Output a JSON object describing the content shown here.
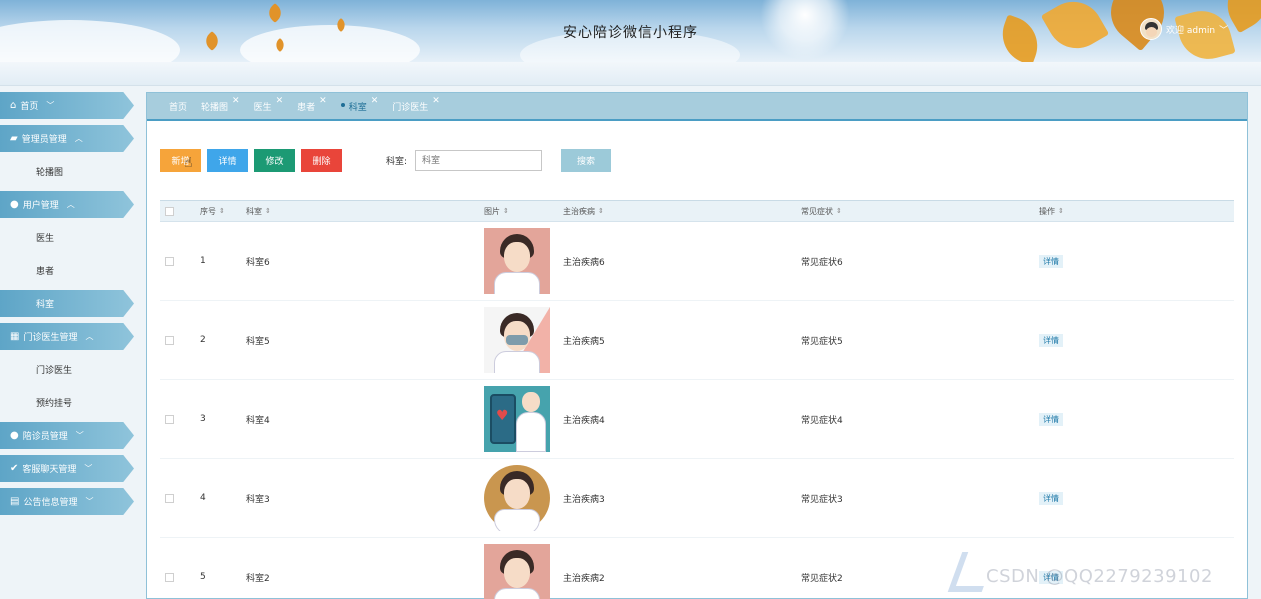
{
  "app": {
    "title": "安心陪诊微信小程序",
    "welcome": "欢迎 admin"
  },
  "sidebar": {
    "items": [
      {
        "label": "首页",
        "type": "head",
        "icon": "home-icon",
        "caret": "﹀"
      },
      {
        "label": "管理员管理",
        "type": "head",
        "icon": "admin-icon",
        "caret": "︿"
      },
      {
        "label": "轮播图",
        "type": "sub"
      },
      {
        "label": "用户管理",
        "type": "head",
        "icon": "user-icon",
        "caret": "︿"
      },
      {
        "label": "医生",
        "type": "sub"
      },
      {
        "label": "患者",
        "type": "sub"
      },
      {
        "label": "科室",
        "type": "sub",
        "active": true
      },
      {
        "label": "门诊医生管理",
        "type": "head",
        "icon": "building-icon",
        "caret": "︿"
      },
      {
        "label": "门诊医生",
        "type": "sub"
      },
      {
        "label": "预约挂号",
        "type": "sub"
      },
      {
        "label": "陪诊员管理",
        "type": "head",
        "icon": "user-icon",
        "caret": "﹀"
      },
      {
        "label": "客服聊天管理",
        "type": "head",
        "icon": "chat-icon",
        "caret": "﹀"
      },
      {
        "label": "公告信息管理",
        "type": "head",
        "icon": "notice-icon",
        "caret": "﹀"
      }
    ]
  },
  "tabs": [
    {
      "label": "首页",
      "closable": false
    },
    {
      "label": "轮播图",
      "closable": true
    },
    {
      "label": "医生",
      "closable": true
    },
    {
      "label": "患者",
      "closable": true
    },
    {
      "label": "科室",
      "closable": true,
      "active": true
    },
    {
      "label": "门诊医生",
      "closable": true
    }
  ],
  "toolbar": {
    "add_label": "新增",
    "detail_label": "详情",
    "edit_label": "修改",
    "delete_label": "删除",
    "search_label": "科室:",
    "search_placeholder": "科室",
    "search_button": "搜索"
  },
  "table": {
    "headers": {
      "no": "序号",
      "dept": "科室",
      "image": "图片",
      "disease": "主治疾病",
      "symptom": "常见症状",
      "op": "操作"
    },
    "rows": [
      {
        "no": "1",
        "dept": "科室6",
        "disease": "主治疾病6",
        "symptom": "常见症状6",
        "op": "详情"
      },
      {
        "no": "2",
        "dept": "科室5",
        "disease": "主治疾病5",
        "symptom": "常见症状5",
        "op": "详情"
      },
      {
        "no": "3",
        "dept": "科室4",
        "disease": "主治疾病4",
        "symptom": "常见症状4",
        "op": "详情"
      },
      {
        "no": "4",
        "dept": "科室3",
        "disease": "主治疾病3",
        "symptom": "常见症状3",
        "op": "详情"
      },
      {
        "no": "5",
        "dept": "科室2",
        "disease": "主治疾病2",
        "symptom": "常见症状2",
        "op": "详情"
      }
    ]
  },
  "watermark": "CSDN @QQ2279239102",
  "colors": {
    "accent": "#5ea5c7",
    "add": "#f6a43a",
    "detail": "#3fa6ea",
    "edit": "#1c9a74",
    "delete": "#e9453a"
  }
}
